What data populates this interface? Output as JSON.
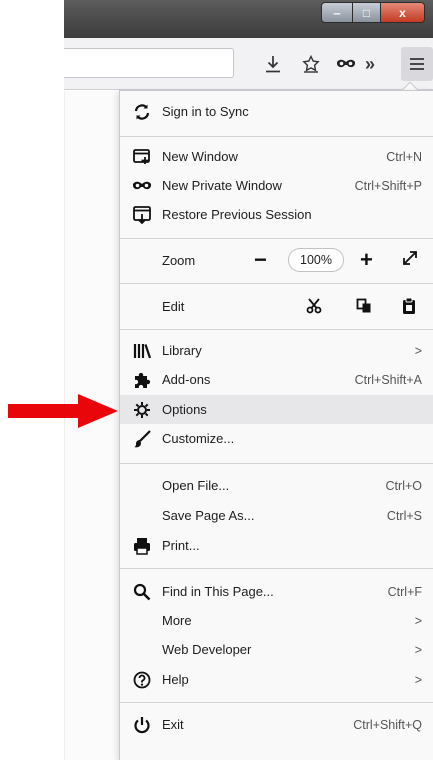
{
  "window": {
    "minimize_glyph": "‒",
    "maximize_glyph": "□",
    "close_glyph": "x"
  },
  "toolbar": {
    "icons": [
      "downloads-icon",
      "bookmark-star-icon",
      "private-mask-icon",
      "overflow-chevron-icon",
      "hamburger-menu-icon"
    ]
  },
  "menu": {
    "sign_in": "Sign in to Sync",
    "new_window": {
      "label": "New Window",
      "shortcut": "Ctrl+N"
    },
    "new_private_window": {
      "label": "New Private Window",
      "shortcut": "Ctrl+Shift+P"
    },
    "restore_session": "Restore Previous Session",
    "zoom": {
      "label": "Zoom",
      "minus": "−",
      "level": "100%",
      "plus": "+"
    },
    "edit": {
      "label": "Edit"
    },
    "library": {
      "label": "Library",
      "arrow": ">"
    },
    "addons": {
      "label": "Add-ons",
      "shortcut": "Ctrl+Shift+A"
    },
    "options": "Options",
    "customize": "Customize...",
    "open_file": {
      "label": "Open File...",
      "shortcut": "Ctrl+O"
    },
    "save_page": {
      "label": "Save Page As...",
      "shortcut": "Ctrl+S"
    },
    "print": "Print...",
    "find": {
      "label": "Find in This Page...",
      "shortcut": "Ctrl+F"
    },
    "more": {
      "label": "More",
      "arrow": ">"
    },
    "web_developer": {
      "label": "Web Developer",
      "arrow": ">"
    },
    "help": {
      "label": "Help",
      "arrow": ">"
    },
    "exit": {
      "label": "Exit",
      "shortcut": "Ctrl+Shift+Q"
    }
  },
  "annotation": {
    "arrow_color": "#e8060b",
    "highlighted_item": "Options"
  }
}
